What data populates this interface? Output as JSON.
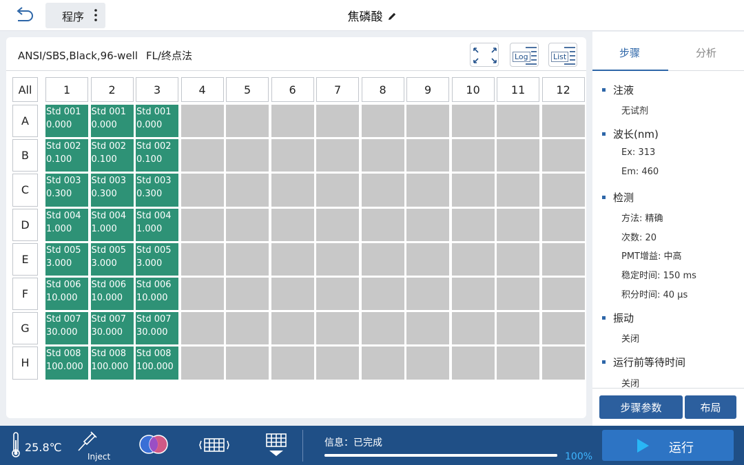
{
  "header": {
    "back_icon": "back-arrow-icon",
    "program_label": "程序",
    "title": "焦磷酸"
  },
  "plate": {
    "description": "ANSI/SBS,Black,96-well",
    "method": "FL/终点法",
    "tools": {
      "log_label": "Log",
      "list_label": "List"
    },
    "all_label": "All",
    "columns": [
      "1",
      "2",
      "3",
      "4",
      "5",
      "6",
      "7",
      "8",
      "9",
      "10",
      "11",
      "12"
    ],
    "rows": [
      "A",
      "B",
      "C",
      "D",
      "E",
      "F",
      "G",
      "H"
    ],
    "standards": [
      {
        "name": "Std 001",
        "value": "0.000"
      },
      {
        "name": "Std 002",
        "value": "0.100"
      },
      {
        "name": "Std 003",
        "value": "0.300"
      },
      {
        "name": "Std 004",
        "value": "1.000"
      },
      {
        "name": "Std 005",
        "value": "3.000"
      },
      {
        "name": "Std 006",
        "value": "10.000"
      },
      {
        "name": "Std 007",
        "value": "30.000"
      },
      {
        "name": "Std 008",
        "value": "100.000"
      }
    ],
    "std_columns": 3,
    "colors": {
      "std_well": "#2e9276",
      "empty_well": "#c8c8c8"
    }
  },
  "sidebar": {
    "tab_steps": "步骤",
    "tab_analysis": "分析",
    "steps": [
      {
        "title": "注液",
        "details": [
          "无试剂"
        ]
      },
      {
        "title": "波长(nm)",
        "details": [
          "Ex: 313",
          "Em: 460"
        ]
      },
      {
        "title": "检测",
        "details": [
          "方法: 精确",
          "次数: 20",
          "PMT增益: 中高",
          "稳定时间: 150 ms",
          "积分时间: 40 μs"
        ]
      },
      {
        "title": "振动",
        "details": [
          "关闭"
        ]
      },
      {
        "title": "运行前等待时间",
        "details": [
          "关闭"
        ]
      }
    ],
    "step_params_label": "步骤参数",
    "layout_label": "布局"
  },
  "footer": {
    "temperature": "25.8℃",
    "inject_label": "Inject",
    "info": "信息：已完成",
    "progress_fraction": 1.0,
    "progress_text": "100%",
    "run_label": "运行"
  }
}
